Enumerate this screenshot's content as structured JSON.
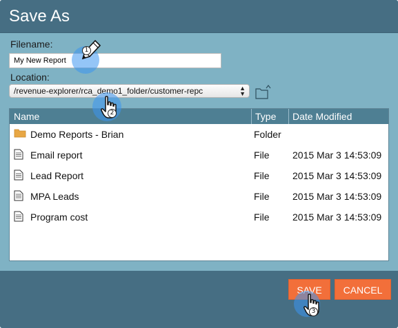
{
  "dialog": {
    "title": "Save As",
    "filename_label": "Filename:",
    "filename_value": "My New Report",
    "location_label": "Location:",
    "location_value": "/revenue-explorer/rca_demo1_folder/customer-repc",
    "new_folder_icon": "new-folder-icon"
  },
  "file_list": {
    "columns": {
      "name": "Name",
      "type": "Type",
      "date": "Date Modified"
    },
    "rows": [
      {
        "name": "Demo Reports - Brian",
        "type": "Folder",
        "date": "",
        "icon": "folder-icon"
      },
      {
        "name": "Email report",
        "type": "File",
        "date": "2015 Mar 3 14:53:09",
        "icon": "document-icon"
      },
      {
        "name": "Lead Report",
        "type": "File",
        "date": "2015 Mar 3 14:53:09",
        "icon": "document-icon"
      },
      {
        "name": "MPA Leads",
        "type": "File",
        "date": "2015 Mar 3 14:53:09",
        "icon": "document-icon"
      },
      {
        "name": "Program cost",
        "type": "File",
        "date": "2015 Mar 3 14:53:09",
        "icon": "document-icon"
      }
    ]
  },
  "buttons": {
    "save": "SAVE",
    "cancel": "CANCEL"
  },
  "annotations": {
    "step1": "1",
    "step2": "2",
    "step3": "3",
    "highlight_color": "#3c96f0"
  },
  "colors": {
    "title_bar": "#466e83",
    "dialog_body": "#7fb2c4",
    "list_header": "#4e7f93",
    "button": "#f26f3a"
  }
}
